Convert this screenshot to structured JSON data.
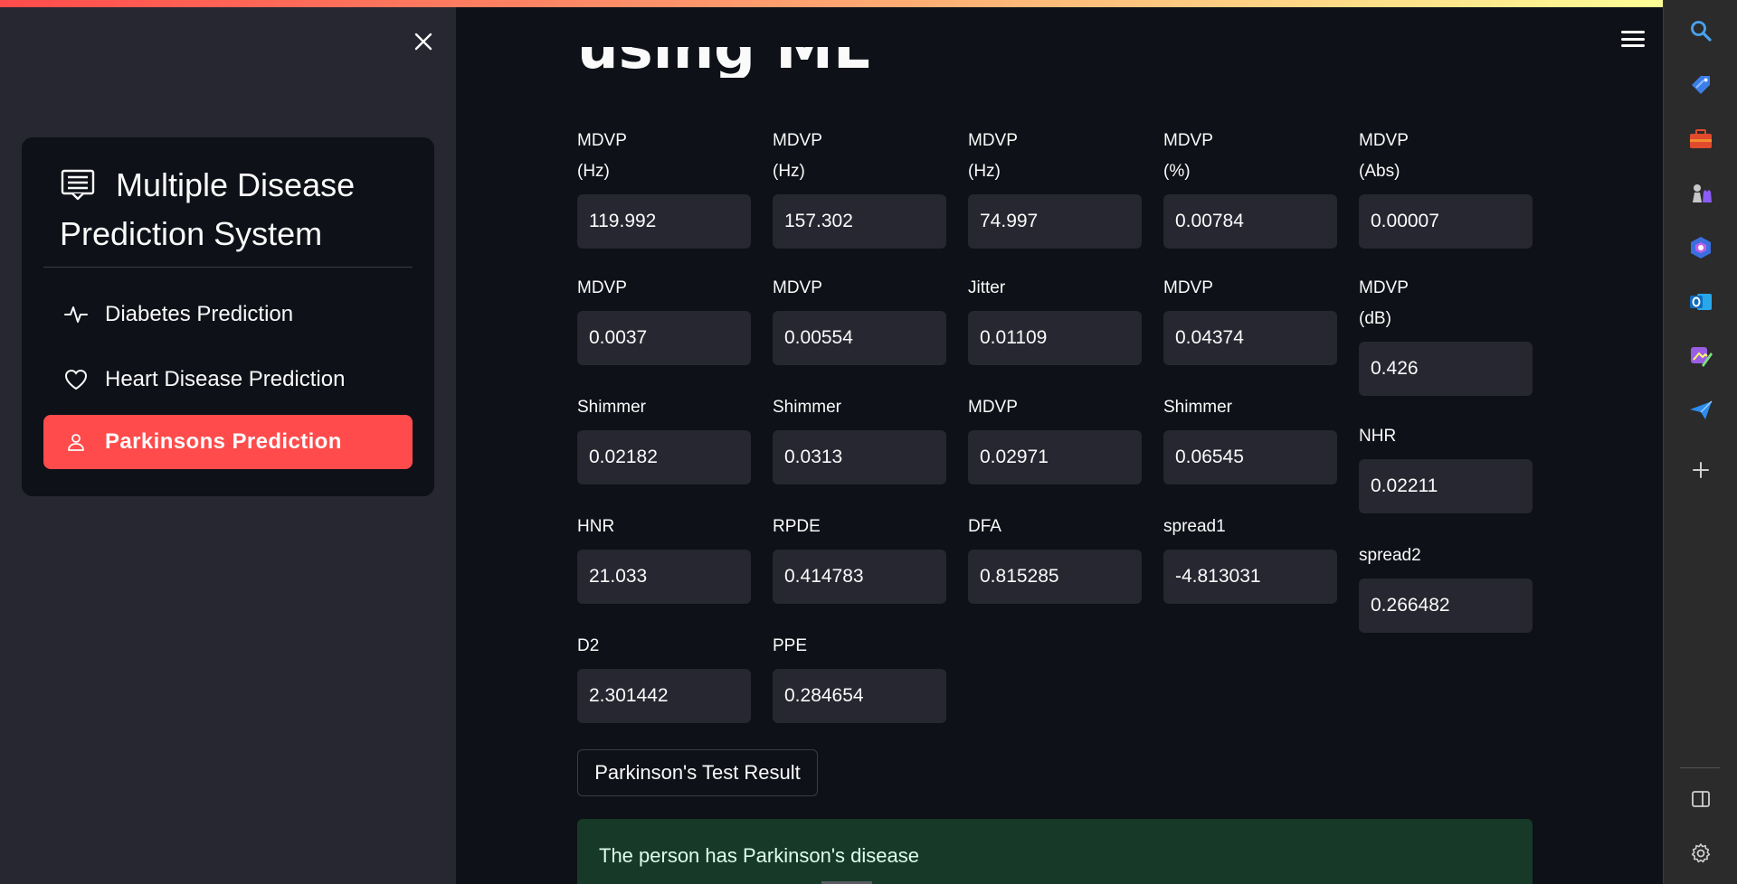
{
  "sidebar": {
    "menu_title": "Multiple Disease Prediction System",
    "items": [
      {
        "label": "Diabetes Prediction",
        "icon": "activity-icon",
        "active": false
      },
      {
        "label": "Heart Disease Prediction",
        "icon": "heart-icon",
        "active": false
      },
      {
        "label": "Parkinsons Prediction",
        "icon": "person-icon",
        "active": true
      }
    ]
  },
  "main": {
    "title_visible": "using ML",
    "fields": [
      {
        "label": "MDVP\n(Hz)",
        "value": "119.992"
      },
      {
        "label": "MDVP\n(Hz)",
        "value": "157.302"
      },
      {
        "label": "MDVP\n(Hz)",
        "value": "74.997"
      },
      {
        "label": "MDVP\n(%)",
        "value": "0.00784"
      },
      {
        "label": "MDVP\n(Abs)",
        "value": "0.00007"
      },
      {
        "label": "MDVP",
        "value": "0.0037"
      },
      {
        "label": "MDVP",
        "value": "0.00554"
      },
      {
        "label": "Jitter",
        "value": "0.01109"
      },
      {
        "label": "MDVP",
        "value": "0.04374"
      },
      {
        "label": "MDVP\n(dB)",
        "value": "0.426"
      },
      {
        "label": "Shimmer",
        "value": "0.02182"
      },
      {
        "label": "Shimmer",
        "value": "0.0313"
      },
      {
        "label": "MDVP",
        "value": "0.02971"
      },
      {
        "label": "Shimmer",
        "value": "0.06545"
      },
      {
        "label": "NHR",
        "value": "0.02211"
      },
      {
        "label": "HNR",
        "value": "21.033"
      },
      {
        "label": "RPDE",
        "value": "0.414783"
      },
      {
        "label": "DFA",
        "value": "0.815285"
      },
      {
        "label": "spread1",
        "value": "-4.813031"
      },
      {
        "label": "spread2",
        "value": "0.266482"
      },
      {
        "label": "D2",
        "value": "2.301442"
      },
      {
        "label": "PPE",
        "value": "0.284654"
      }
    ],
    "result_button": "Parkinson's Test Result",
    "result_message": "The person has Parkinson's disease"
  },
  "colors": {
    "accent": "#ff4b4b",
    "background": "#0e1117",
    "sidebar": "#262730",
    "success_bg": "#173928"
  },
  "browser_sidebar": {
    "icons": [
      "search-icon",
      "shopping-tag-icon",
      "briefcase-icon",
      "games-icon",
      "copilot-icon",
      "outlook-icon",
      "designer-icon",
      "send-icon",
      "add-icon",
      "split-screen-icon",
      "settings-icon"
    ]
  }
}
